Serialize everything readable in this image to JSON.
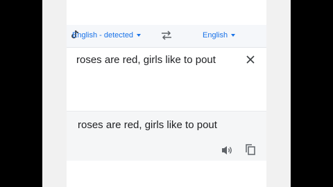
{
  "language_bar": {
    "source_language": "English - detected",
    "target_language": "English"
  },
  "source": {
    "text": "roses are red, girls like to pout"
  },
  "result": {
    "text": "roses are red, girls like to pout"
  },
  "icons": {
    "swap": "swap-arrows-icon",
    "close": "close-icon",
    "speaker": "speaker-icon",
    "copy": "copy-icon",
    "watermark": "tiktok-logo"
  },
  "colors": {
    "accent": "#1a73e8",
    "text": "#202124",
    "icon": "#5f6368",
    "source_speaker": "#1a73e8"
  }
}
